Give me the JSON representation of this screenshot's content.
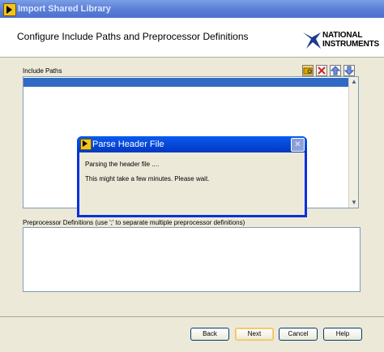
{
  "window": {
    "title": "Import Shared Library"
  },
  "header": {
    "title": "Configure Include Paths and Preprocessor Definitions",
    "logo_line1": "NATIONAL",
    "logo_line2": "INSTRUMENTS"
  },
  "include_paths": {
    "label": "Include Paths",
    "toolbar": {
      "browse_icon": "folder-browse-icon",
      "delete_icon": "delete-x-icon",
      "up_icon": "move-up-icon",
      "down_icon": "move-down-icon"
    },
    "scroll_up": "▲",
    "scroll_down": "▼"
  },
  "preprocessor": {
    "label": "Preprocessor Definitions (use ';' to separate multiple preprocessor definitions)"
  },
  "buttons": {
    "back": "Back",
    "next": "Next",
    "cancel": "Cancel",
    "help": "Help"
  },
  "dialog": {
    "title": "Parse Header File",
    "message": "Parsing the header file  ....",
    "wait": "This might take a few minutes. Please wait.",
    "close": "✕"
  }
}
